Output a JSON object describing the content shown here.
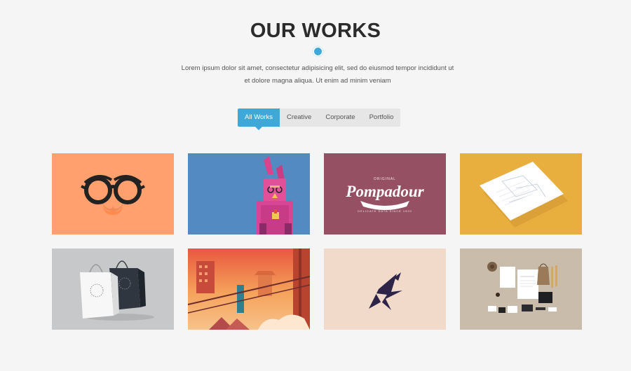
{
  "section": {
    "title": "OUR WORKS",
    "description_line1": "Lorem ipsum dolor sit amet, consectetur adipisicing elit, sed do eiusmod tempor incididunt ut",
    "description_line2": "et dolore magna aliqua. Ut enim ad minim veniam"
  },
  "filters": [
    {
      "label": "All Works",
      "active": true
    },
    {
      "label": "Creative",
      "active": false
    },
    {
      "label": "Corporate",
      "active": false
    },
    {
      "label": "Portfolio",
      "active": false
    }
  ],
  "portfolio": {
    "items": [
      {
        "name": "glasses-mustache",
        "bg": "#ffa06e"
      },
      {
        "name": "pink-rabbit",
        "bg": "#4f86bf"
      },
      {
        "name": "pompadour-logo",
        "bg": "#955063",
        "logo_text": "Pompadour"
      },
      {
        "name": "letterhead-paper",
        "bg": "#e8ae3e"
      },
      {
        "name": "shopping-bags",
        "bg": "#c7c8ca"
      },
      {
        "name": "sunset-city",
        "bg": "#ef8f47"
      },
      {
        "name": "bird-logo",
        "bg": "#f2dacb"
      },
      {
        "name": "stationery-flatlay",
        "bg": "#c9bcaa"
      }
    ]
  },
  "colors": {
    "accent": "#3ea9d8",
    "background": "#f5f5f5"
  }
}
